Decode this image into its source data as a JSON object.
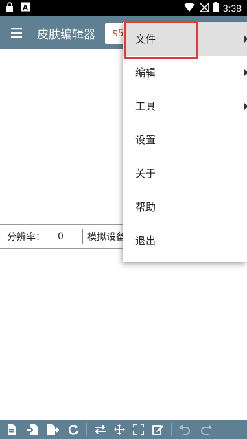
{
  "status_bar": {
    "time": "3:38",
    "icons": [
      "lock-icon",
      "notification-a-icon",
      "wifi-icon",
      "no-sim-icon",
      "battery-icon"
    ]
  },
  "app_bar": {
    "title": "皮肤编辑器",
    "value_text": "$5",
    "menu_icon": "hamburger-icon",
    "color": "#5f7f92"
  },
  "info_row": {
    "resolution_label": "分辨率：",
    "resolution_value": "0",
    "device_label": "模拟设备"
  },
  "menu": {
    "items": [
      {
        "label": "文件",
        "has_submenu": true
      },
      {
        "label": "编辑",
        "has_submenu": true
      },
      {
        "label": "工具",
        "has_submenu": true
      },
      {
        "label": "设置",
        "has_submenu": false
      },
      {
        "label": "关于",
        "has_submenu": false
      },
      {
        "label": "帮助",
        "has_submenu": false
      },
      {
        "label": "退出",
        "has_submenu": false
      }
    ],
    "highlight_color": "#e53935"
  },
  "bottom_toolbar": {
    "icons": [
      "new-file-icon",
      "import-icon",
      "export-icon",
      "refresh-icon",
      "swap-icon",
      "move-icon",
      "fullscreen-icon",
      "edit-icon",
      "undo-icon",
      "redo-icon"
    ]
  }
}
